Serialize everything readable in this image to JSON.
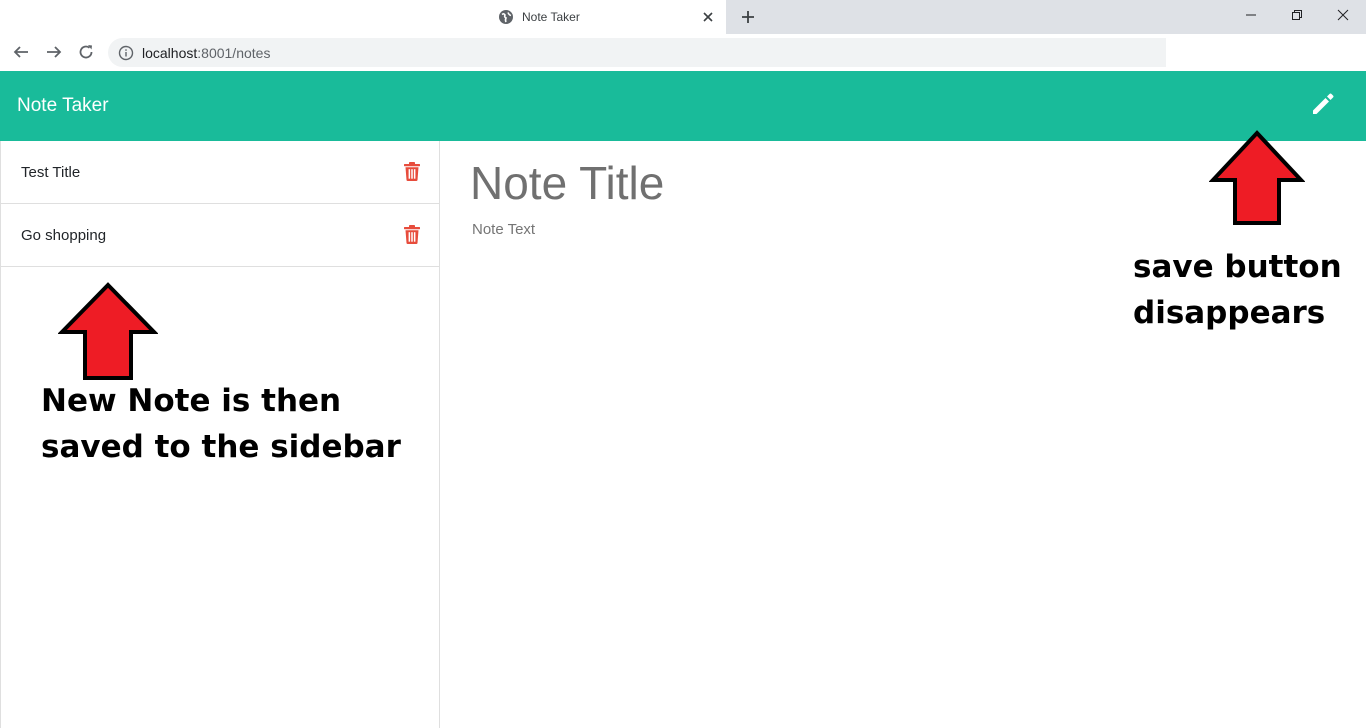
{
  "browser": {
    "tab_title": "Note Taker",
    "url_host": "localhost",
    "url_path": ":8001/notes"
  },
  "app": {
    "brand": "Note Taker"
  },
  "sidebar": {
    "notes": [
      {
        "title": "Test Title"
      },
      {
        "title": "Go shopping"
      }
    ]
  },
  "editor": {
    "title_placeholder": "Note Title",
    "text_placeholder": "Note Text"
  },
  "annotations": {
    "sidebar_line1": "New Note is then",
    "sidebar_line2": "saved to the sidebar",
    "save_line1": "save button",
    "save_line2": "disappears"
  },
  "colors": {
    "header": "#19bb9a",
    "trash": "#e74c3c",
    "arrow": "#ee1c25"
  },
  "icons": {
    "tab": "globe-icon",
    "edit": "pencil-icon",
    "delete": "trash-icon",
    "address": "info-icon"
  }
}
